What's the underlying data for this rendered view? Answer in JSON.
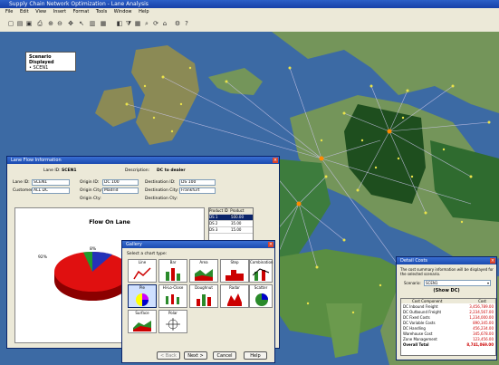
{
  "app": {
    "title": "Supply Chain Network Optimization - Lane Analysis",
    "menu": [
      "File",
      "Edit",
      "View",
      "Insert",
      "Format",
      "Tools",
      "Window",
      "Help"
    ]
  },
  "legend": {
    "title": "Scenario Displayed",
    "value": "• SCEN1"
  },
  "lane_window": {
    "title": "Lane Flow Information",
    "lane_id_label": "Lane ID:",
    "lane_id": "SCEN1",
    "description_label": "Description:",
    "description": "DC to dealer",
    "lane_id_field_label": "Lane ID:",
    "lane_id_field": "SCEN1",
    "customer_label": "Customer:",
    "customer": "ALL DC",
    "origin_id_label": "Origin ID:",
    "origin_id": "DC 100",
    "destination_id_label": "Destination ID:",
    "destination_id": "DS 100",
    "origin_city_label": "Origin City:",
    "origin_city": "Madrid",
    "destination_city_label": "Destination City:",
    "destination_city": "Frankfurt",
    "origin_cty_label": "Origin Cty:",
    "destination_cty_label": "Destination Cty:",
    "chart_title": "Flow On Lane",
    "pie_labels": [
      "92%",
      "8%"
    ],
    "grid_headers": [
      "Product ID",
      "Product Flow"
    ],
    "grid_rows": [
      [
        "DS 1",
        "500.00"
      ],
      [
        "DS 2",
        "35.00"
      ],
      [
        "DS 3",
        "15.00"
      ]
    ]
  },
  "gallery": {
    "title": "Gallery",
    "prompt": "Select a chart type:",
    "cells": [
      "Line",
      "Bar",
      "Area",
      "Step",
      "Combination",
      "Pie",
      "Hi-Lo-Close",
      "Doughnut",
      "Radar",
      "Scatter",
      "Surface",
      "Polar"
    ],
    "buttons": {
      "back": "< Back",
      "next": "Next >",
      "cancel": "Cancel",
      "help": "Help"
    }
  },
  "detail_window": {
    "title": "Detail Costs",
    "note": "The cost summary information will be displayed for the selected scenario.",
    "scenario_label": "Scenario:",
    "scenario": "SCEN1",
    "subtitle": "(Show DC)",
    "headers": [
      "Cost Component",
      "Cost"
    ],
    "rows": [
      [
        "DC Inbound Freight",
        "3,456,789.00"
      ],
      [
        "DC Outbound Freight",
        "2,234,567.00"
      ],
      [
        "DC Fixed Costs",
        "1,234,000.00"
      ],
      [
        "DC Variable Costs",
        "890,345.00"
      ],
      [
        "DC Handling",
        "456,234.00"
      ],
      [
        "Warehouse Cost",
        "345,678.00"
      ],
      [
        "Zone Management",
        "123,456.00"
      ],
      [
        "Overall Total",
        "8,741,069.00"
      ]
    ]
  },
  "colors": {
    "sea": "#3c6aa4",
    "land": "#74955a",
    "highlight_land": "#1e4e1e",
    "node": "#e9e24a",
    "lane": "#c9c4e8"
  }
}
